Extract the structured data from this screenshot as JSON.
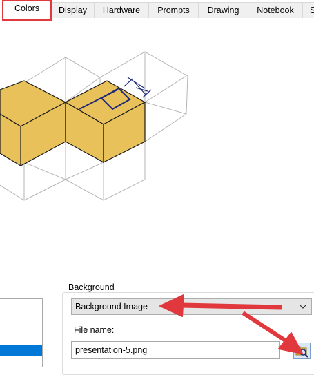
{
  "tabs": [
    {
      "label": "Colors",
      "active": true
    },
    {
      "label": "Display",
      "active": false
    },
    {
      "label": "Hardware",
      "active": false
    },
    {
      "label": "Prompts",
      "active": false
    },
    {
      "label": "Drawing",
      "active": false
    },
    {
      "label": "Notebook",
      "active": false
    },
    {
      "label": "S",
      "active": false
    }
  ],
  "background_group": {
    "title": "Background",
    "selected_option": "Background Image",
    "file_name_label": "File name:",
    "file_name_value": "presentation-5.png",
    "browse_icon": "folder-search-icon"
  },
  "colors": {
    "face": "#e8c15a",
    "edge": "#1a1a1a",
    "wire": "#b5b5b5",
    "dimension": "#1f2a78",
    "highlight": "#e0383c",
    "selection": "#0078d7"
  }
}
